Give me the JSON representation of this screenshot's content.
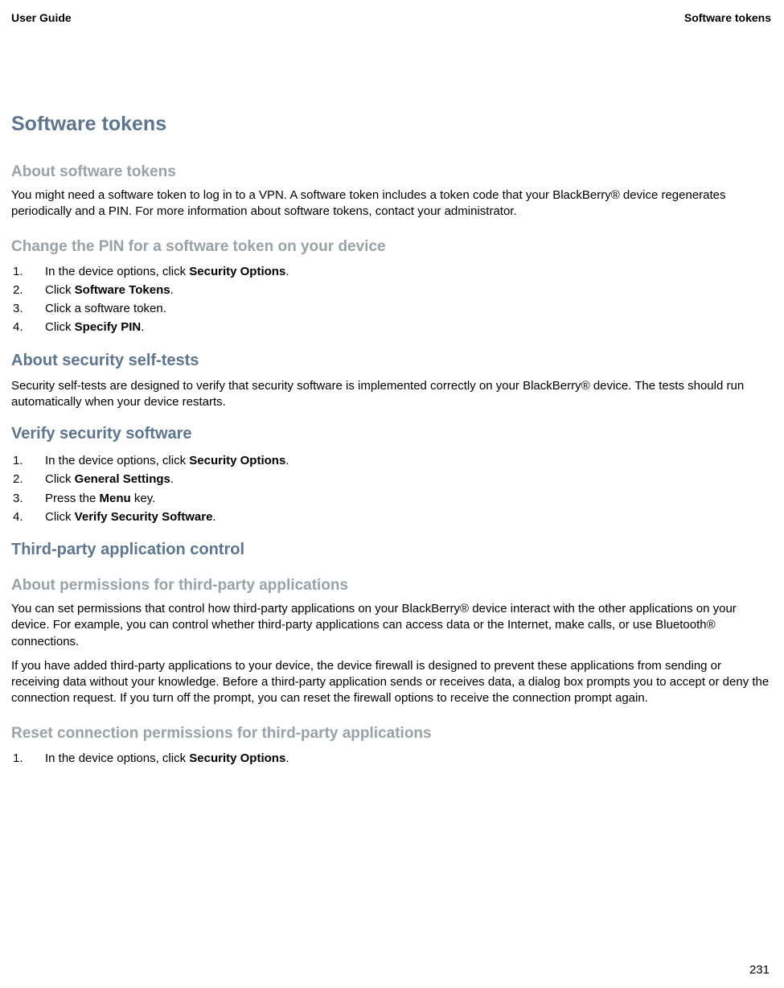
{
  "header": {
    "left": "User Guide",
    "right": "Software tokens"
  },
  "chapter_title": "Software tokens",
  "sections": {
    "about_tokens": {
      "heading": "About software tokens",
      "para": "You might need a software token to log in to a VPN. A software token includes a token code that your BlackBerry® device regenerates periodically and a PIN. For more information about software tokens, contact your administrator."
    },
    "change_pin": {
      "heading": "Change the PIN for a software token on your device",
      "steps": [
        {
          "pre": "In the device options, click ",
          "bold": "Security Options",
          "post": "."
        },
        {
          "pre": "Click ",
          "bold": "Software Tokens",
          "post": "."
        },
        {
          "pre": "Click a software token.",
          "bold": "",
          "post": ""
        },
        {
          "pre": "Click ",
          "bold": "Specify PIN",
          "post": "."
        }
      ]
    },
    "about_selftests": {
      "heading": "About security self-tests",
      "para": "Security self-tests are designed to verify that security software is implemented correctly on your BlackBerry® device. The tests should run automatically when your device restarts."
    },
    "verify_software": {
      "heading": "Verify security software",
      "steps": [
        {
          "pre": "In the device options, click ",
          "bold": "Security Options",
          "post": "."
        },
        {
          "pre": "Click ",
          "bold": "General Settings",
          "post": "."
        },
        {
          "pre": "Press the ",
          "bold": "Menu",
          "post": " key."
        },
        {
          "pre": "Click ",
          "bold": "Verify Security Software",
          "post": "."
        }
      ]
    },
    "third_party_control": {
      "heading": "Third-party application control"
    },
    "about_permissions": {
      "heading": "About permissions for third-party applications",
      "para1": "You can set permissions that control how third-party applications on your BlackBerry® device interact with the other applications on your device. For example, you can control whether third-party applications can access data or the Internet, make calls, or use Bluetooth® connections.",
      "para2": "If you have added third-party applications to your device, the device firewall is designed to prevent these applications from sending or receiving data without your knowledge. Before a third-party application sends or receives data, a dialog box prompts you to accept or deny the connection request. If you turn off the prompt, you can reset the firewall options to receive the connection prompt again."
    },
    "reset_permissions": {
      "heading": "Reset connection permissions for third-party applications",
      "steps": [
        {
          "pre": "In the device options, click ",
          "bold": "Security Options",
          "post": "."
        }
      ]
    }
  },
  "page_number": "231"
}
